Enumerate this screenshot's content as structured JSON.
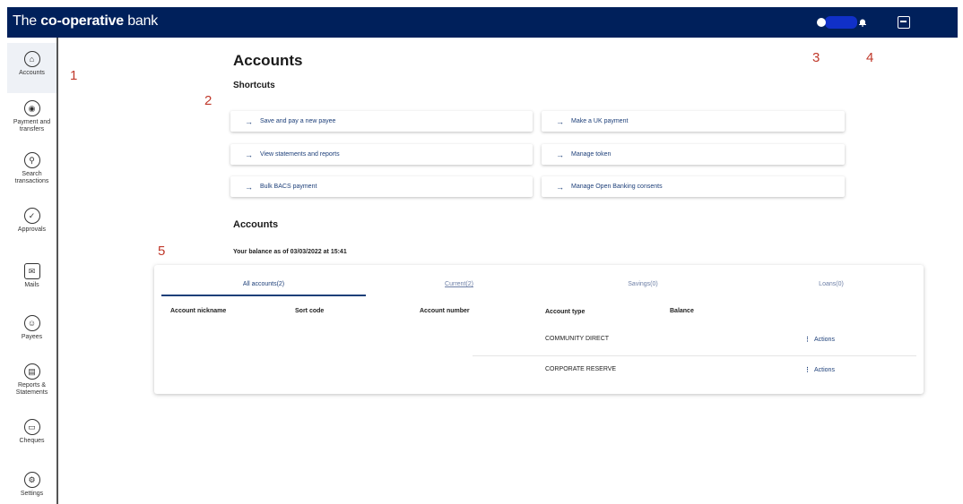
{
  "app": {
    "brand_prefix": "The ",
    "brand_bold": "co-operative",
    "brand_suffix": " bank"
  },
  "header_icons": [
    "user-icon",
    "bell-icon",
    "logout-icon"
  ],
  "sidebar": {
    "items": [
      {
        "label": "Accounts",
        "icon": "home-icon"
      },
      {
        "label": "Payment and transfers",
        "icon": "payment-icon"
      },
      {
        "label": "Search transactions",
        "icon": "search-icon"
      },
      {
        "label": "Approvals",
        "icon": "approvals-icon"
      },
      {
        "label": "Mails",
        "icon": "mail-icon"
      },
      {
        "label": "Payees",
        "icon": "payee-icon"
      },
      {
        "label": "Reports & Statements",
        "icon": "report-icon"
      },
      {
        "label": "Cheques",
        "icon": "cheque-icon"
      },
      {
        "label": "Settings",
        "icon": "settings-icon"
      }
    ]
  },
  "annotations": {
    "a1": "1",
    "a2": "2",
    "a3": "3",
    "a4": "4",
    "a5": "5"
  },
  "main": {
    "title": "Accounts",
    "shortcuts_heading": "Shortcuts",
    "shortcuts": [
      "Save and pay a new payee",
      "Make a UK payment",
      "View statements and reports",
      "Manage token",
      "Bulk BACS payment",
      "Manage Open Banking consents"
    ],
    "accounts_heading": "Accounts",
    "balance_text": "Your balance as of 03/03/2022 at 15:41"
  },
  "panel": {
    "tabs": [
      "All accounts(2)",
      "Current(2)",
      "Savings(0)",
      "Loans(0)"
    ],
    "columns": [
      "Account nickname",
      "Sort code",
      "Account number",
      "Account type",
      "Balance"
    ],
    "rows": [
      {
        "account_type": "COMMUNITY DIRECT",
        "action": "Actions"
      },
      {
        "account_type": "CORPORATE RESERVE",
        "action": "Actions"
      }
    ]
  },
  "colors": {
    "header_bg": "#00205b",
    "accent": "#1d3f79",
    "annotation": "#c0392b"
  }
}
